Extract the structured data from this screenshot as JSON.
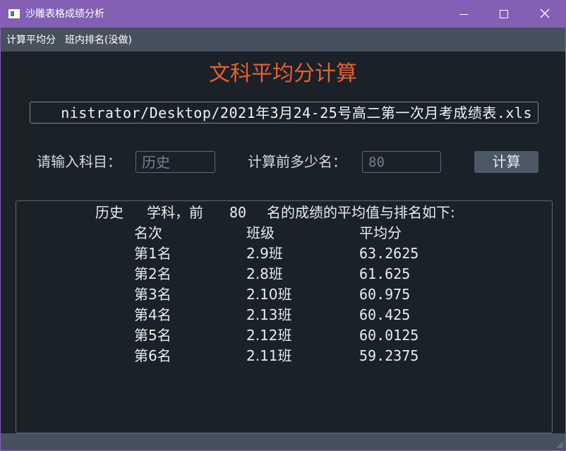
{
  "window": {
    "title": "沙雕表格成绩分析"
  },
  "menu": {
    "items": [
      "计算平均分",
      "班内排名(没做)"
    ]
  },
  "main": {
    "heading": "文科平均分计算",
    "file_path": "nistrator/Desktop/2021年3月24-25号高二第一次月考成绩表.xls",
    "subject_label": "请输入科目：",
    "subject_placeholder": "历史",
    "count_label": "计算前多少名：",
    "count_placeholder": "80",
    "calc_button": "计算"
  },
  "result": {
    "summary_subject": "历史",
    "summary_mid": "学科，前",
    "summary_n": "80",
    "summary_tail": "名的成绩的平均值与排名如下:",
    "headers": {
      "rank": "名次",
      "class": "班级",
      "average": "平均分"
    },
    "rows": [
      {
        "rank": "第1名",
        "class": "2.9班",
        "average": "63.2625"
      },
      {
        "rank": "第2名",
        "class": "2.8班",
        "average": "61.625"
      },
      {
        "rank": "第3名",
        "class": "2.10班",
        "average": "60.975"
      },
      {
        "rank": "第4名",
        "class": "2.13班",
        "average": "60.425"
      },
      {
        "rank": "第5名",
        "class": "2.12班",
        "average": "60.0125"
      },
      {
        "rank": "第6名",
        "class": "2.11班",
        "average": "59.2375"
      }
    ]
  },
  "colors": {
    "titlebar": "#8360b4",
    "heading": "#e8602a",
    "background": "#1a2129",
    "menubar": "#47515d"
  },
  "icons": {
    "app": "app-window-icon",
    "minimize": "minimize-icon",
    "maximize": "maximize-icon",
    "close": "close-icon"
  }
}
